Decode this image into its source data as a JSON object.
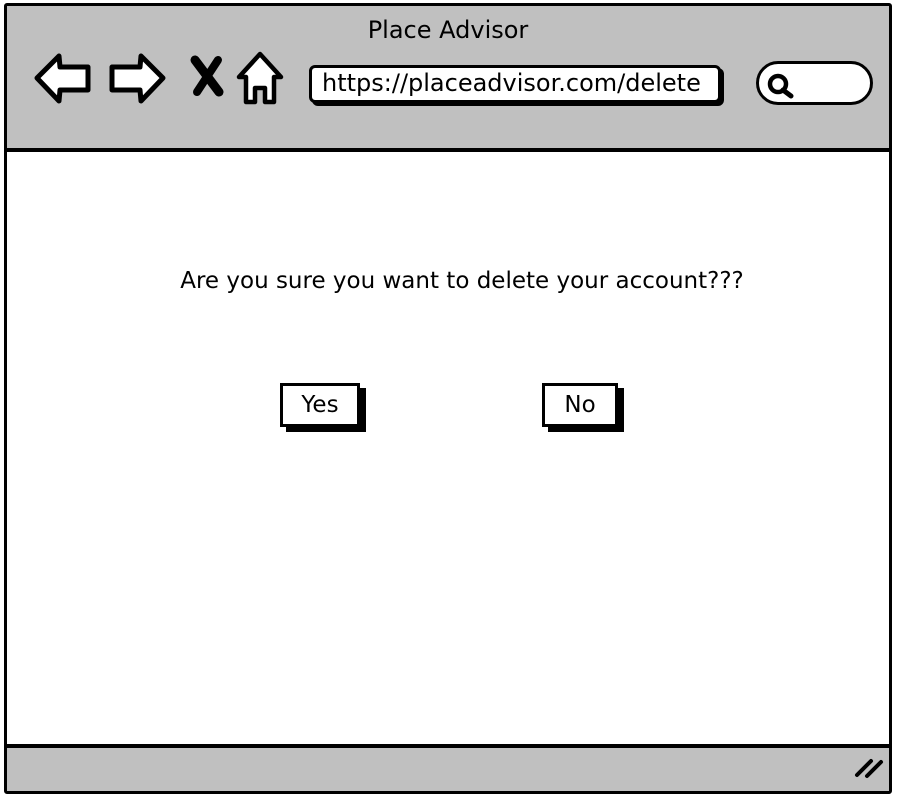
{
  "window": {
    "title": "Place Advisor"
  },
  "toolbar": {
    "back_icon": "back-arrow-icon",
    "forward_icon": "forward-arrow-icon",
    "stop_icon": "stop-x-icon",
    "home_icon": "home-icon",
    "url": "https://placeadvisor.com/delete",
    "search_icon": "search-icon"
  },
  "dialog": {
    "question": "Are you sure you want to delete your account???",
    "yes_label": "Yes",
    "no_label": "No"
  },
  "statusbar": {
    "grip_icon": "resize-grip-icon"
  },
  "colors": {
    "chrome": "#c0c0c0",
    "border": "#000000",
    "background": "#ffffff"
  }
}
